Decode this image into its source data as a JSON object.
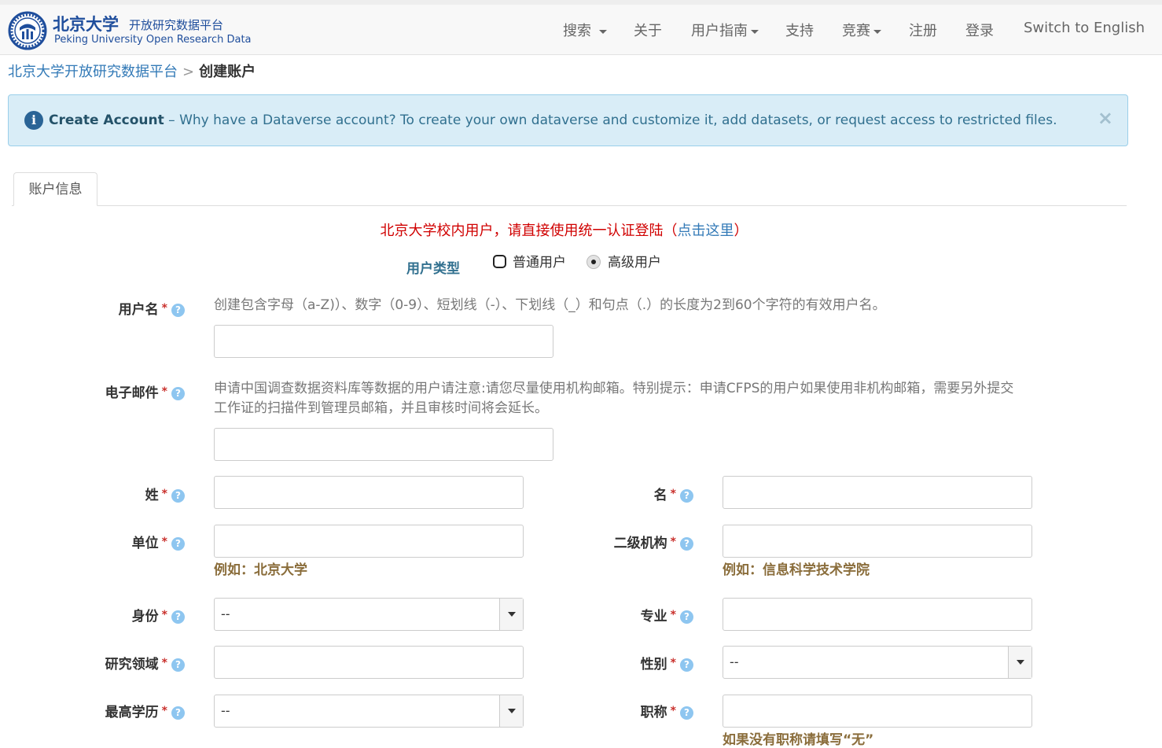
{
  "header": {
    "logo_cn": "北京大学",
    "logo_sub": "开放研究数据平台",
    "logo_en": "Peking University Open Research Data",
    "nav": [
      "搜索",
      "关于",
      "用户指南",
      "支持",
      "竞赛",
      "注册",
      "登录",
      "Switch to English"
    ]
  },
  "breadcrumb": {
    "root": "北京大学开放研究数据平台",
    "separator": ">",
    "current": "创建账户"
  },
  "alert": {
    "title": "Create Account",
    "text": " – Why have a Dataverse account? To create your own dataverse and customize it, add datasets, or request access to restricted files.",
    "close": "×"
  },
  "tab": {
    "label": "账户信息"
  },
  "notice": {
    "text": "北京大学校内用户，请直接使用统一认证登陆（",
    "link": "点击这里",
    "end": "）"
  },
  "user_type": {
    "label": "用户类型",
    "options": [
      "普通用户",
      "高级用户"
    ],
    "selected": "高级用户"
  },
  "form": {
    "required_mark": "*",
    "help_mark": "?",
    "username": {
      "label": "用户名",
      "desc": "创建包含字母（a-Z)）、数字（0-9）、短划线（-）、下划线（_）和句点（.）的长度为2到60个字符的有效用户名。",
      "value": ""
    },
    "email": {
      "label": "电子邮件",
      "desc": "申请中国调查数据资料库等数据的用户请注意:请您尽量使用机构邮箱。特别提示：申请CFPS的用户如果使用非机构邮箱，需要另外提交工作证的扫描件到管理员邮箱，并且审核时间将会延长。",
      "value": ""
    },
    "surname": {
      "label": "姓",
      "value": ""
    },
    "given_name": {
      "label": "名",
      "value": ""
    },
    "affiliation": {
      "label": "单位",
      "value": "",
      "example": "例如：北京大学"
    },
    "department": {
      "label": "二级机构",
      "value": "",
      "example": "例如：信息科学技术学院"
    },
    "identity": {
      "label": "身份",
      "value": "--"
    },
    "major": {
      "label": "专业",
      "value": ""
    },
    "research_field": {
      "label": "研究领域",
      "value": ""
    },
    "gender": {
      "label": "性别",
      "value": "--"
    },
    "education": {
      "label": "最高学历",
      "value": "--"
    },
    "title": {
      "label": "职称",
      "value": "",
      "hint": "如果没有职称请填写“无”"
    }
  }
}
